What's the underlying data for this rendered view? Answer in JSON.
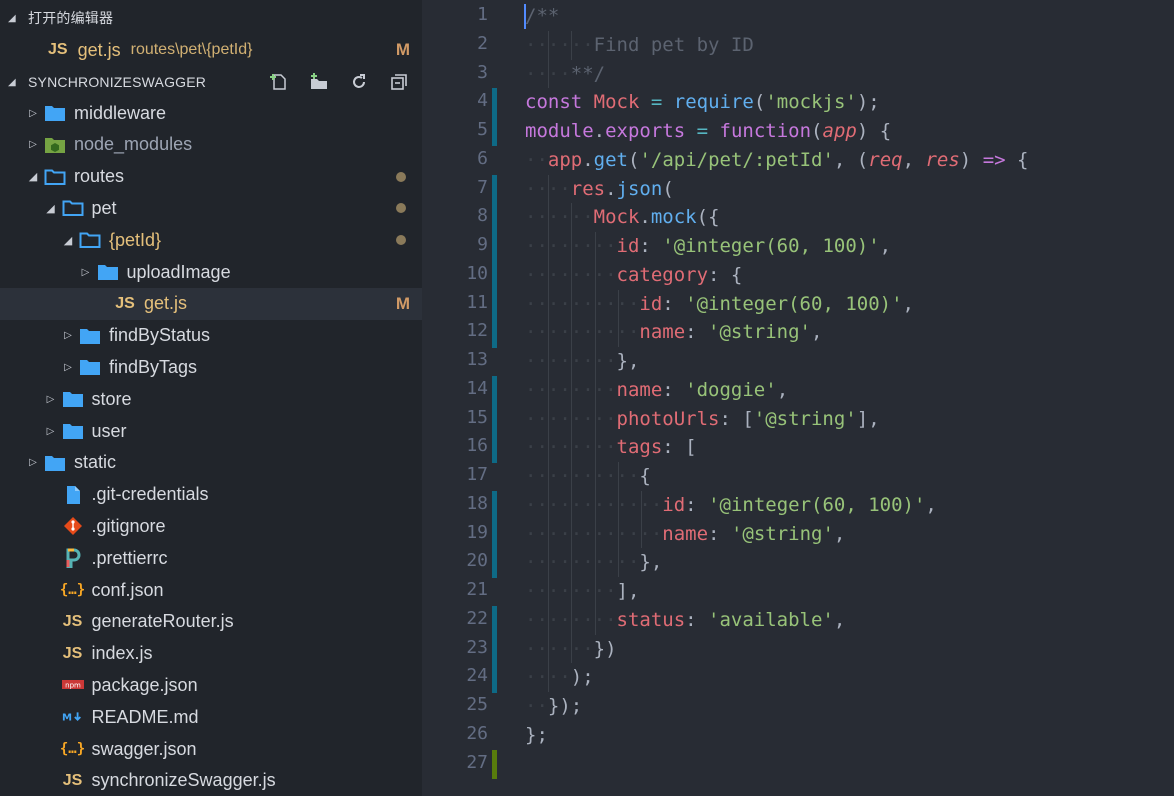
{
  "sidebar": {
    "open_editors_title": "打开的编辑器",
    "open_editor": {
      "name": "get.js",
      "path": "routes\\pet\\{petId}",
      "status": "M"
    },
    "project_title": "SYNCHRONIZESWAGGER",
    "actions": [
      "new-file-icon",
      "new-folder-icon",
      "refresh-icon",
      "collapse-all-icon"
    ],
    "tree": [
      {
        "label": "middleware",
        "type": "folder",
        "depth": 0,
        "twisty": "closed"
      },
      {
        "label": "node_modules",
        "type": "node-folder",
        "depth": 0,
        "twisty": "closed",
        "dim": true
      },
      {
        "label": "routes",
        "type": "folder-open",
        "depth": 0,
        "twisty": "open",
        "dot": true
      },
      {
        "label": "pet",
        "type": "folder-open",
        "depth": 1,
        "twisty": "open",
        "dot": true
      },
      {
        "label": "{petId}",
        "type": "folder-open",
        "depth": 2,
        "twisty": "open",
        "dot": true,
        "yellow": true
      },
      {
        "label": "uploadImage",
        "type": "folder",
        "depth": 3,
        "twisty": "closed"
      },
      {
        "label": "get.js",
        "type": "js",
        "depth": 4,
        "twisty": "none",
        "status": "M",
        "selected": true,
        "yellow": true
      },
      {
        "label": "findByStatus",
        "type": "folder",
        "depth": 2,
        "twisty": "closed"
      },
      {
        "label": "findByTags",
        "type": "folder",
        "depth": 2,
        "twisty": "closed"
      },
      {
        "label": "store",
        "type": "folder",
        "depth": 1,
        "twisty": "closed"
      },
      {
        "label": "user",
        "type": "folder",
        "depth": 1,
        "twisty": "closed"
      },
      {
        "label": "static",
        "type": "folder",
        "depth": 0,
        "twisty": "closed"
      },
      {
        "label": ".git-credentials",
        "type": "file",
        "depth": 1,
        "twisty": "none"
      },
      {
        "label": ".gitignore",
        "type": "git",
        "depth": 1,
        "twisty": "none"
      },
      {
        "label": ".prettierrc",
        "type": "prettier",
        "depth": 1,
        "twisty": "none"
      },
      {
        "label": "conf.json",
        "type": "json",
        "depth": 1,
        "twisty": "none"
      },
      {
        "label": "generateRouter.js",
        "type": "js",
        "depth": 1,
        "twisty": "none"
      },
      {
        "label": "index.js",
        "type": "js",
        "depth": 1,
        "twisty": "none"
      },
      {
        "label": "package.json",
        "type": "npm",
        "depth": 1,
        "twisty": "none"
      },
      {
        "label": "README.md",
        "type": "md",
        "depth": 1,
        "twisty": "none"
      },
      {
        "label": "swagger.json",
        "type": "json",
        "depth": 1,
        "twisty": "none"
      },
      {
        "label": "synchronizeSwagger.js",
        "type": "js",
        "depth": 1,
        "twisty": "none"
      }
    ]
  },
  "editor": {
    "lines": [
      {
        "n": "1",
        "indent": 0,
        "mod": "none",
        "tokens": [
          [
            "c",
            "/**"
          ]
        ]
      },
      {
        "n": "2",
        "indent": 3,
        "mod": "none",
        "tokens": [
          [
            "c",
            "Find pet by ID"
          ]
        ]
      },
      {
        "n": "3",
        "indent": 2,
        "mod": "none",
        "tokens": [
          [
            "c",
            "**/"
          ]
        ]
      },
      {
        "n": "4",
        "indent": 0,
        "mod": "blue",
        "tokens": [
          [
            "k",
            "const"
          ],
          [
            "p",
            " "
          ],
          [
            "v",
            "Mock"
          ],
          [
            "p",
            " "
          ],
          [
            "op",
            "="
          ],
          [
            "p",
            " "
          ],
          [
            "fn",
            "require"
          ],
          [
            "p",
            "("
          ],
          [
            "s",
            "'mockjs'"
          ],
          [
            "p",
            ");"
          ]
        ]
      },
      {
        "n": "5",
        "indent": 0,
        "mod": "blue",
        "tokens": [
          [
            "k",
            "module"
          ],
          [
            "p",
            "."
          ],
          [
            "k",
            "exports"
          ],
          [
            "p",
            " "
          ],
          [
            "op",
            "="
          ],
          [
            "p",
            " "
          ],
          [
            "k",
            "function"
          ],
          [
            "p",
            "("
          ],
          [
            "param",
            "app"
          ],
          [
            "p",
            ") {"
          ]
        ]
      },
      {
        "n": "6",
        "indent": 1,
        "mod": "none",
        "tokens": [
          [
            "v",
            "app"
          ],
          [
            "p",
            "."
          ],
          [
            "fn",
            "get"
          ],
          [
            "p",
            "("
          ],
          [
            "s",
            "'/api/pet/:petId'"
          ],
          [
            "p",
            ", ("
          ],
          [
            "param",
            "req"
          ],
          [
            "p",
            ", "
          ],
          [
            "param",
            "res"
          ],
          [
            "p",
            ") "
          ],
          [
            "k",
            "=>"
          ],
          [
            "p",
            " {"
          ]
        ]
      },
      {
        "n": "7",
        "indent": 2,
        "mod": "blue",
        "tokens": [
          [
            "v",
            "res"
          ],
          [
            "p",
            "."
          ],
          [
            "fn",
            "json"
          ],
          [
            "p",
            "("
          ]
        ]
      },
      {
        "n": "8",
        "indent": 3,
        "mod": "blue",
        "tokens": [
          [
            "v",
            "Mock"
          ],
          [
            "p",
            "."
          ],
          [
            "fn",
            "mock"
          ],
          [
            "p",
            "({"
          ]
        ]
      },
      {
        "n": "9",
        "indent": 4,
        "mod": "blue",
        "tokens": [
          [
            "prop",
            "id"
          ],
          [
            "p",
            ": "
          ],
          [
            "s",
            "'@integer(60, 100)'"
          ],
          [
            "p",
            ","
          ]
        ]
      },
      {
        "n": "10",
        "indent": 4,
        "mod": "blue",
        "tokens": [
          [
            "prop",
            "category"
          ],
          [
            "p",
            ": {"
          ]
        ]
      },
      {
        "n": "11",
        "indent": 5,
        "mod": "blue",
        "tokens": [
          [
            "prop",
            "id"
          ],
          [
            "p",
            ": "
          ],
          [
            "s",
            "'@integer(60, 100)'"
          ],
          [
            "p",
            ","
          ]
        ]
      },
      {
        "n": "12",
        "indent": 5,
        "mod": "blue",
        "tokens": [
          [
            "prop",
            "name"
          ],
          [
            "p",
            ": "
          ],
          [
            "s",
            "'@string'"
          ],
          [
            "p",
            ","
          ]
        ]
      },
      {
        "n": "13",
        "indent": 4,
        "mod": "none",
        "tokens": [
          [
            "p",
            "},"
          ]
        ]
      },
      {
        "n": "14",
        "indent": 4,
        "mod": "blue",
        "tokens": [
          [
            "prop",
            "name"
          ],
          [
            "p",
            ": "
          ],
          [
            "s",
            "'doggie'"
          ],
          [
            "p",
            ","
          ]
        ]
      },
      {
        "n": "15",
        "indent": 4,
        "mod": "blue",
        "tokens": [
          [
            "prop",
            "photoUrls"
          ],
          [
            "p",
            ": ["
          ],
          [
            "s",
            "'@string'"
          ],
          [
            "p",
            "],"
          ]
        ]
      },
      {
        "n": "16",
        "indent": 4,
        "mod": "blue",
        "tokens": [
          [
            "prop",
            "tags"
          ],
          [
            "p",
            ": ["
          ]
        ]
      },
      {
        "n": "17",
        "indent": 5,
        "mod": "none",
        "tokens": [
          [
            "p",
            "{"
          ]
        ]
      },
      {
        "n": "18",
        "indent": 6,
        "mod": "blue",
        "tokens": [
          [
            "prop",
            "id"
          ],
          [
            "p",
            ": "
          ],
          [
            "s",
            "'@integer(60, 100)'"
          ],
          [
            "p",
            ","
          ]
        ]
      },
      {
        "n": "19",
        "indent": 6,
        "mod": "blue",
        "tokens": [
          [
            "prop",
            "name"
          ],
          [
            "p",
            ": "
          ],
          [
            "s",
            "'@string'"
          ],
          [
            "p",
            ","
          ]
        ]
      },
      {
        "n": "20",
        "indent": 5,
        "mod": "blue",
        "tokens": [
          [
            "p",
            "},"
          ]
        ]
      },
      {
        "n": "21",
        "indent": 4,
        "mod": "none",
        "tokens": [
          [
            "p",
            "],"
          ]
        ]
      },
      {
        "n": "22",
        "indent": 4,
        "mod": "blue",
        "tokens": [
          [
            "prop",
            "status"
          ],
          [
            "p",
            ": "
          ],
          [
            "s",
            "'available'"
          ],
          [
            "p",
            ","
          ]
        ]
      },
      {
        "n": "23",
        "indent": 3,
        "mod": "blue",
        "tokens": [
          [
            "p",
            "})"
          ]
        ]
      },
      {
        "n": "24",
        "indent": 2,
        "mod": "blue",
        "tokens": [
          [
            "p",
            ");"
          ]
        ]
      },
      {
        "n": "25",
        "indent": 1,
        "mod": "none",
        "tokens": [
          [
            "p",
            "});"
          ]
        ]
      },
      {
        "n": "26",
        "indent": 0,
        "mod": "none",
        "tokens": [
          [
            "p",
            "};"
          ]
        ]
      },
      {
        "n": "27",
        "indent": 0,
        "mod": "green",
        "tokens": []
      }
    ],
    "colors": {
      "mod_blue": "#0e6a86",
      "mod_green": "#587c0c",
      "folder": "#42a5f5",
      "js": "#e5c07b"
    }
  }
}
